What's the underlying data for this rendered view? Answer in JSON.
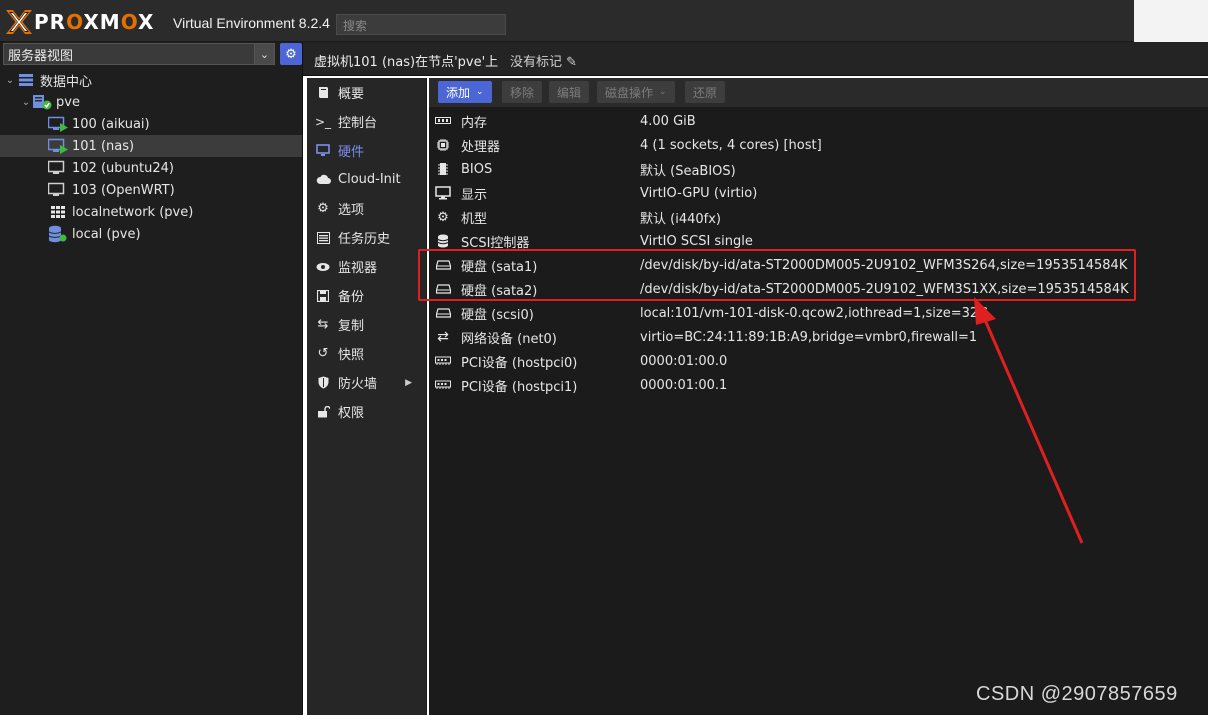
{
  "header": {
    "logo_text": "PROXMOX",
    "product": "Virtual Environment 8.2.4",
    "search_placeholder": "搜索"
  },
  "left": {
    "view_label": "服务器视图",
    "tree": [
      {
        "label": "数据中心",
        "type": "datacenter"
      },
      {
        "label": "pve",
        "type": "node"
      },
      {
        "label": "100 (aikuai)",
        "type": "vm-running"
      },
      {
        "label": "101 (nas)",
        "type": "vm-running",
        "selected": true
      },
      {
        "label": "102 (ubuntu24)",
        "type": "vm-stopped"
      },
      {
        "label": "103 (OpenWRT)",
        "type": "vm-stopped"
      },
      {
        "label": "localnetwork (pve)",
        "type": "network"
      },
      {
        "label": "local (pve)",
        "type": "storage"
      }
    ]
  },
  "main_header": {
    "title": "虚拟机101 (nas)在节点'pve'上",
    "tags": "没有标记"
  },
  "nav": {
    "items": [
      {
        "label": "概要",
        "icon": "book-icon"
      },
      {
        "label": "控制台",
        "icon": "terminal-icon"
      },
      {
        "label": "硬件",
        "icon": "monitor-icon",
        "active": true
      },
      {
        "label": "Cloud-Init",
        "icon": "cloud-icon"
      },
      {
        "label": "选项",
        "icon": "gear-icon"
      },
      {
        "label": "任务历史",
        "icon": "list-icon"
      },
      {
        "label": "监视器",
        "icon": "eye-icon"
      },
      {
        "label": "备份",
        "icon": "floppy-icon"
      },
      {
        "label": "复制",
        "icon": "retweet-icon"
      },
      {
        "label": "快照",
        "icon": "history-icon"
      },
      {
        "label": "防火墙",
        "icon": "shield-icon",
        "has_submenu": true
      },
      {
        "label": "权限",
        "icon": "unlock-icon"
      }
    ]
  },
  "toolbar": {
    "add": "添加",
    "remove": "移除",
    "edit": "编辑",
    "disk_action": "磁盘操作",
    "revert": "还原"
  },
  "hardware": [
    {
      "key": "内存",
      "value": "4.00 GiB",
      "icon": "memory-icon"
    },
    {
      "key": "处理器",
      "value": "4 (1 sockets, 4 cores) [host]",
      "icon": "cpu-icon"
    },
    {
      "key": "BIOS",
      "value": "默认 (SeaBIOS)",
      "icon": "chip-icon"
    },
    {
      "key": "显示",
      "value": "VirtIO-GPU (virtio)",
      "icon": "desktop-icon"
    },
    {
      "key": "机型",
      "value": "默认 (i440fx)",
      "icon": "cogs-icon"
    },
    {
      "key": "SCSI控制器",
      "value": "VirtIO SCSI single",
      "icon": "database-icon"
    },
    {
      "key": "硬盘 (sata1)",
      "value": "/dev/disk/by-id/ata-ST2000DM005-2U9102_WFM3S264,size=1953514584K",
      "icon": "hdd-icon"
    },
    {
      "key": "硬盘 (sata2)",
      "value": "/dev/disk/by-id/ata-ST2000DM005-2U9102_WFM3S1XX,size=1953514584K",
      "icon": "hdd-icon"
    },
    {
      "key": "硬盘 (scsi0)",
      "value": "local:101/vm-101-disk-0.qcow2,iothread=1,size=32G",
      "icon": "hdd-icon"
    },
    {
      "key": "网络设备 (net0)",
      "value": "virtio=BC:24:11:89:1B:A9,bridge=vmbr0,firewall=1",
      "icon": "exchange-icon"
    },
    {
      "key": "PCI设备 (hostpci0)",
      "value": "0000:01:00.0",
      "icon": "pci-icon"
    },
    {
      "key": "PCI设备 (hostpci1)",
      "value": "0000:01:00.1",
      "icon": "pci-icon"
    }
  ],
  "watermark": "CSDN @2907857659",
  "colors": {
    "accent": "#4c66d6",
    "brand_orange": "#e57000",
    "annotation_red": "#e02020",
    "running_green": "#3fb93f"
  }
}
